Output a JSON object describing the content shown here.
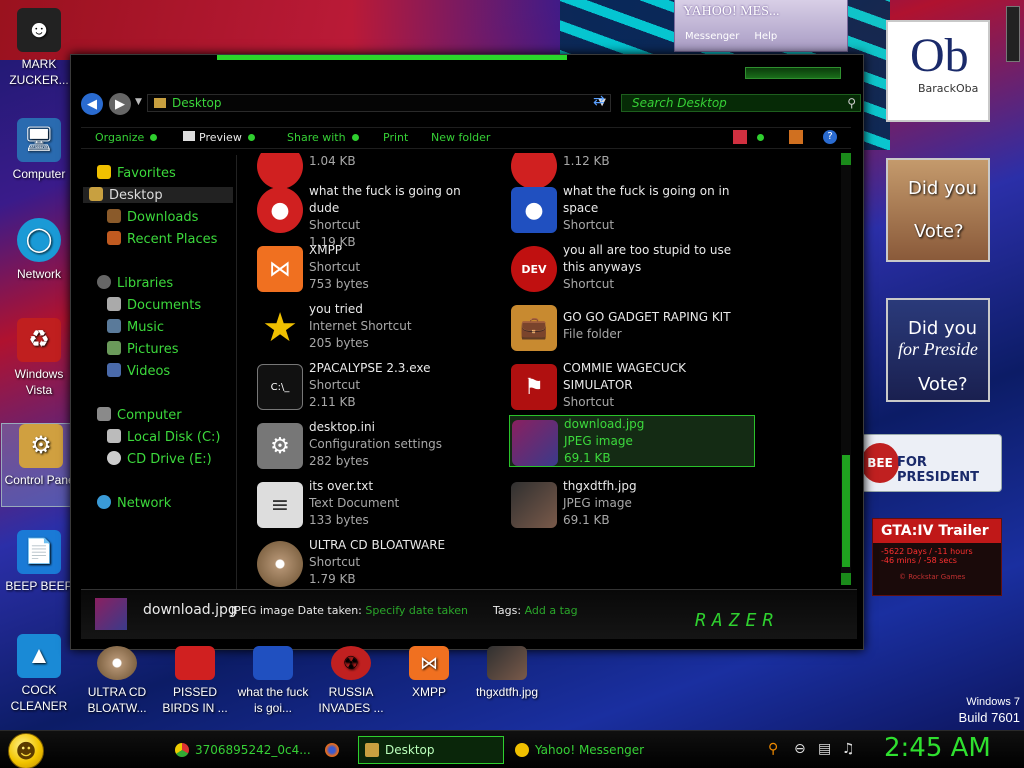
{
  "desktop_left_icons": [
    {
      "label": "MARK ZUCKER...",
      "icon": "person-icon",
      "color": "#222222"
    },
    {
      "label": "Computer",
      "icon": "computer-icon",
      "color": "#2a6bb0"
    },
    {
      "label": "Network",
      "icon": "network-icon",
      "color": "#1a9ad6"
    },
    {
      "label": "Windows Vista",
      "icon": "recycle-bin-icon",
      "color": "#c01f1f"
    },
    {
      "label": "Control Panel",
      "icon": "control-panel-icon",
      "color": "#d0a040"
    },
    {
      "label": "BEEP BEEP",
      "icon": "file-icon",
      "color": "#1a7ad6"
    },
    {
      "label": "COCK CLEANER",
      "icon": "app-icon",
      "color": "#1a8ad6"
    }
  ],
  "desktop_bottom_icons": [
    {
      "label": "ULTRA CD BLOATW...",
      "icon": "disc-icon",
      "color": "#b09070"
    },
    {
      "label": "PISSED BIRDS IN ...",
      "icon": "angry-bird-icon",
      "color": "#d02020"
    },
    {
      "label": "what the fuck is goi...",
      "icon": "angry-bird-space-icon",
      "color": "#2050c0"
    },
    {
      "label": "RUSSIA INVADES ...",
      "icon": "radiation-icon",
      "color": "#c02020"
    },
    {
      "label": "XMPP",
      "icon": "xampp-icon",
      "color": "#f07020"
    },
    {
      "label": "thgxdtfh.jpg",
      "icon": "image-icon",
      "color": "#303030"
    }
  ],
  "top_icons": [
    {
      "icon": "document-icon",
      "color": "#d33a3a"
    },
    {
      "icon": "command-prompt-icon",
      "color": "#111111"
    },
    {
      "icon": "books-icon",
      "color": "#3a8ad0"
    },
    {
      "icon": "pig-icon",
      "color": "#3ab03a"
    },
    {
      "icon": "p-logo-icon",
      "color": "#e04020"
    },
    {
      "icon": "dev-cpp-icon",
      "color": "#c01010"
    },
    {
      "icon": "image-icon",
      "color": "#8a2060"
    }
  ],
  "yahoo_window": {
    "title": "YAHOO! MES...",
    "menu1": "Messenger",
    "menu2": "Help"
  },
  "side_widgets": {
    "obama": {
      "big": "Ob",
      "small": "BarackOba"
    },
    "did_you_vote": {
      "line1": "Did you",
      "line2": "Vote?"
    },
    "did_you_for_president": {
      "line1": "Did you",
      "line2": "for Preside",
      "line3": "Vote?"
    },
    "bee": {
      "left": "BEE",
      "text": "FOR PRESIDENT"
    },
    "gta": {
      "title": "GTA:IV Trailer",
      "line1": "-5622 Days / -11 hours",
      "line2": "-46 mins / -58 secs",
      "footer": "© Rockstar Games"
    }
  },
  "explorer": {
    "address": "Desktop",
    "search_placeholder": "Search Desktop",
    "toolbar": {
      "organize": "Organize",
      "preview": "Preview",
      "share": "Share with",
      "print": "Print",
      "new_folder": "New folder"
    },
    "nav": {
      "favorites": "Favorites",
      "desktop": "Desktop",
      "downloads": "Downloads",
      "recent": "Recent Places",
      "libraries": "Libraries",
      "documents": "Documents",
      "music": "Music",
      "pictures": "Pictures",
      "videos": "Videos",
      "computer": "Computer",
      "local_disk": "Local Disk (C:)",
      "cd_drive": "CD Drive (E:)",
      "network": "Network"
    },
    "files_left": [
      {
        "name": "",
        "type": "",
        "size": "1.04 KB",
        "icon": "angry-bird-icon",
        "color": "#d02020"
      },
      {
        "name": "what the fuck is going on dude",
        "type": "Shortcut",
        "size": "1.19 KB",
        "icon": "angry-bird-icon",
        "color": "#d02020"
      },
      {
        "name": "XMPP",
        "type": "Shortcut",
        "size": "753 bytes",
        "icon": "xampp-icon",
        "color": "#f07020"
      },
      {
        "name": "you tried",
        "type": "Internet Shortcut",
        "size": "205 bytes",
        "icon": "star-icon",
        "color": "#f0c000"
      },
      {
        "name": "2PACALYPSE 2.3.exe",
        "type": "Shortcut",
        "size": "2.11 KB",
        "icon": "command-prompt-icon",
        "color": "#111111"
      },
      {
        "name": "desktop.ini",
        "type": "Configuration settings",
        "size": "282 bytes",
        "icon": "settings-file-icon",
        "color": "#888888"
      },
      {
        "name": "its over.txt",
        "type": "Text Document",
        "size": "133 bytes",
        "icon": "text-file-icon",
        "color": "#dddddd"
      },
      {
        "name": "ULTRA CD BLOATWARE",
        "type": "Shortcut",
        "size": "1.79 KB",
        "icon": "disc-icon",
        "color": "#b09070"
      }
    ],
    "files_right": [
      {
        "name": "",
        "type": "",
        "size": "1.12 KB",
        "icon": "pig-icon",
        "color": "#d02020"
      },
      {
        "name": "what the fuck is going on in space",
        "type": "Shortcut",
        "size": "",
        "icon": "angry-bird-space-icon",
        "color": "#2050c0"
      },
      {
        "name": "you all are too stupid to use this anyways",
        "type": "Shortcut",
        "size": "",
        "icon": "dev-cpp-icon",
        "color": "#c01010"
      },
      {
        "name": "GO GO GADGET RAPING KIT",
        "type": "File folder",
        "size": "",
        "icon": "briefcase-icon",
        "color": "#c88a30"
      },
      {
        "name": "COMMIE WAGECUCK SIMULATOR",
        "type": "Shortcut",
        "size": "",
        "icon": "flag-icon",
        "color": "#b01010"
      },
      {
        "name": "download.jpg",
        "type": "JPEG image",
        "size": "69.1 KB",
        "icon": "image-icon",
        "color": "#8a2060",
        "selected": true
      },
      {
        "name": "thgxdtfh.jpg",
        "type": "JPEG image",
        "size": "69.1 KB",
        "icon": "image-icon",
        "color": "#303030"
      }
    ],
    "details": {
      "name": "download.jpg",
      "type_label": "JPEG image",
      "date_label": "Date taken:",
      "date_value": "Specify date taken",
      "tags_label": "Tags:",
      "tags_value": "Add a tag",
      "brand": "RAZER"
    }
  },
  "os_info": {
    "line1": "Windows 7",
    "line2": "Build 7601"
  },
  "taskbar": {
    "items": [
      {
        "label": "3706895242_0c4...",
        "icon": "chrome-icon",
        "color": "#e8b020"
      },
      {
        "label": "",
        "icon": "firefox-icon",
        "color": "#e06a20"
      },
      {
        "label": "Desktop",
        "icon": "folder-icon",
        "color": "#c8a040",
        "active": true
      },
      {
        "label": "Yahoo! Messenger",
        "icon": "yahoo-smiley-icon",
        "color": "#f0c000"
      }
    ],
    "clock": "2:45 AM"
  }
}
